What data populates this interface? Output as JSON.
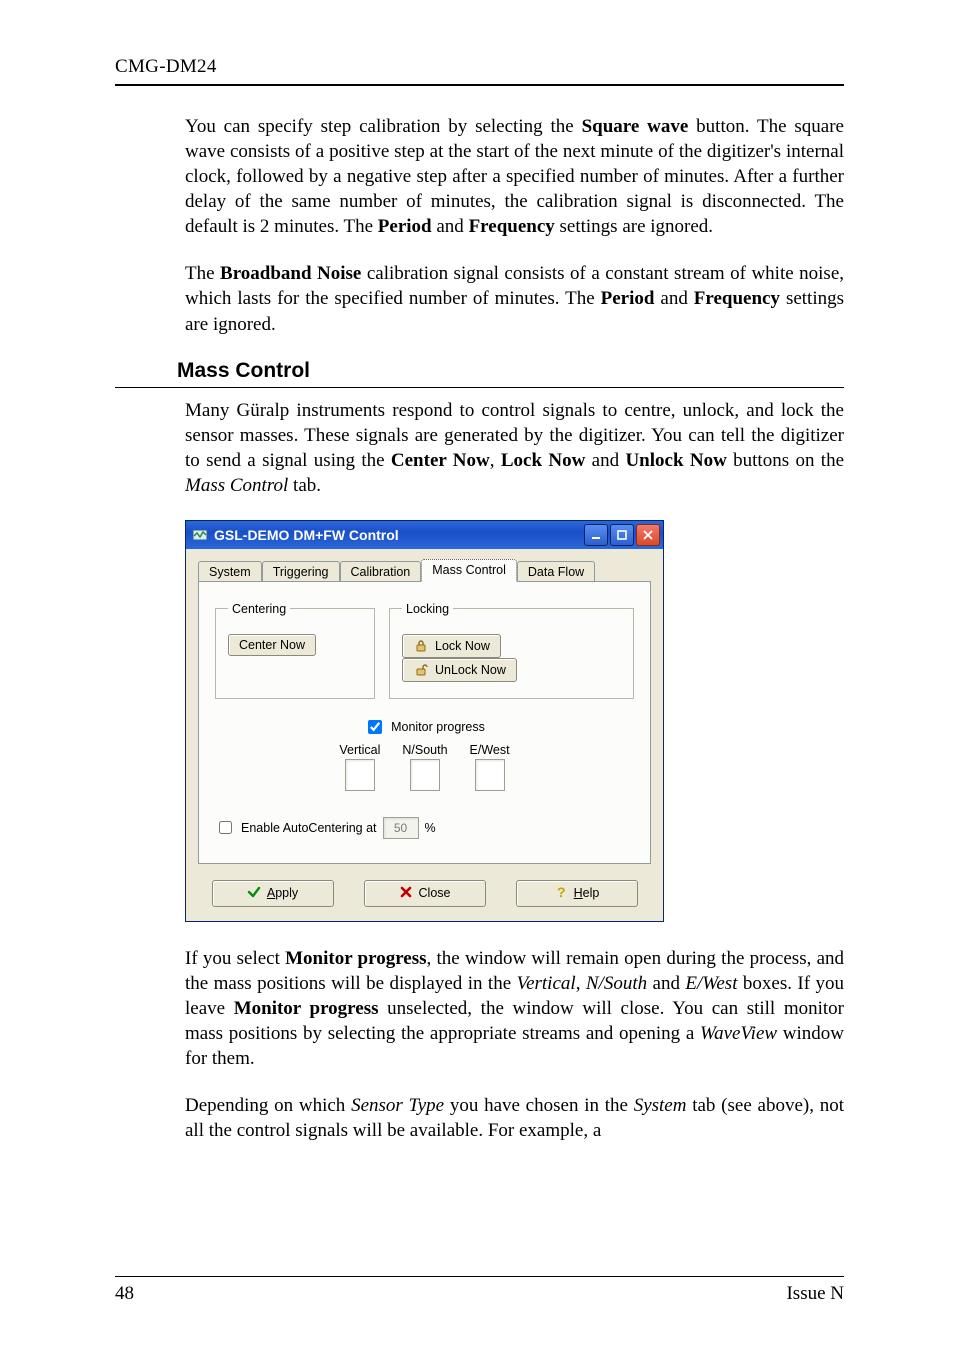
{
  "header": {
    "running_head": "CMG-DM24"
  },
  "paras": {
    "p1a": "You can specify step calibration by selecting the ",
    "p1b": "Square wave",
    "p1c": " button. The square wave consists of a positive step at the start of the next minute of the digitizer's internal clock, followed by a negative step after a specified number of minutes. After a further delay of the same number of minutes, the calibration signal is disconnected. The default is 2 minutes. The ",
    "p1d": "Period",
    "p1e": " and ",
    "p1f": "Frequency",
    "p1g": " settings are ignored.",
    "p2a": "The ",
    "p2b": "Broadband Noise",
    "p2c": " calibration signal consists of a constant stream of white noise, which lasts for the specified number of minutes. The ",
    "p2d": "Period",
    "p2e": " and ",
    "p2f": "Frequency",
    "p2g": " settings are ignored.",
    "sec_heading": "Mass Control",
    "p3a": "Many Güralp instruments respond to control signals to centre, unlock, and lock the sensor masses. These signals are generated by the digitizer. You can tell the digitizer to send a signal using the ",
    "p3b": "Center Now",
    "p3c": ", ",
    "p3d": "Lock Now",
    "p3e": " and ",
    "p3f": "Unlock Now",
    "p3g": " buttons on the ",
    "p3h": "Mass Control",
    "p3i": " tab.",
    "p4a": "If you select ",
    "p4b": "Monitor progress",
    "p4c": ", the window will remain open during the process, and the mass positions will be displayed in the ",
    "p4d": "Vertical",
    "p4e": ", ",
    "p4f": "N/South",
    "p4g": " and ",
    "p4h": "E/West",
    "p4i": " boxes. If you leave ",
    "p4j": "Monitor progress",
    "p4k": " unselected, the window will close. You can still monitor mass positions by selecting the appropriate streams and opening a ",
    "p4l": "WaveView",
    "p4m": " window for them.",
    "p5a": "Depending on which ",
    "p5b": "Sensor Type",
    "p5c": " you have chosen in the ",
    "p5d": "System",
    "p5e": " tab (see above), not all the control signals will be available. For example, a"
  },
  "win": {
    "title": "GSL-DEMO DM+FW Control",
    "tabs": {
      "system": "System",
      "triggering": "Triggering",
      "calibration": "Calibration",
      "mass": "Mass Control",
      "dataflow": "Data Flow"
    },
    "centering_legend": "Centering",
    "center_now": "Center Now",
    "locking_legend": "Locking",
    "lock_now": "Lock Now",
    "unlock_now": "UnLock Now",
    "monitor_label": "Monitor progress",
    "col_vertical": "Vertical",
    "col_nsouth": "N/South",
    "col_ewest": "E/West",
    "auto_label_pre": "Enable AutoCentering at ",
    "auto_value": "50",
    "auto_label_post": " %",
    "apply_pre": "A",
    "apply_rest": "pply",
    "close_label": "Close",
    "help_pre": "H",
    "help_rest": "elp"
  },
  "footer": {
    "page": "48",
    "issue": "Issue N"
  }
}
